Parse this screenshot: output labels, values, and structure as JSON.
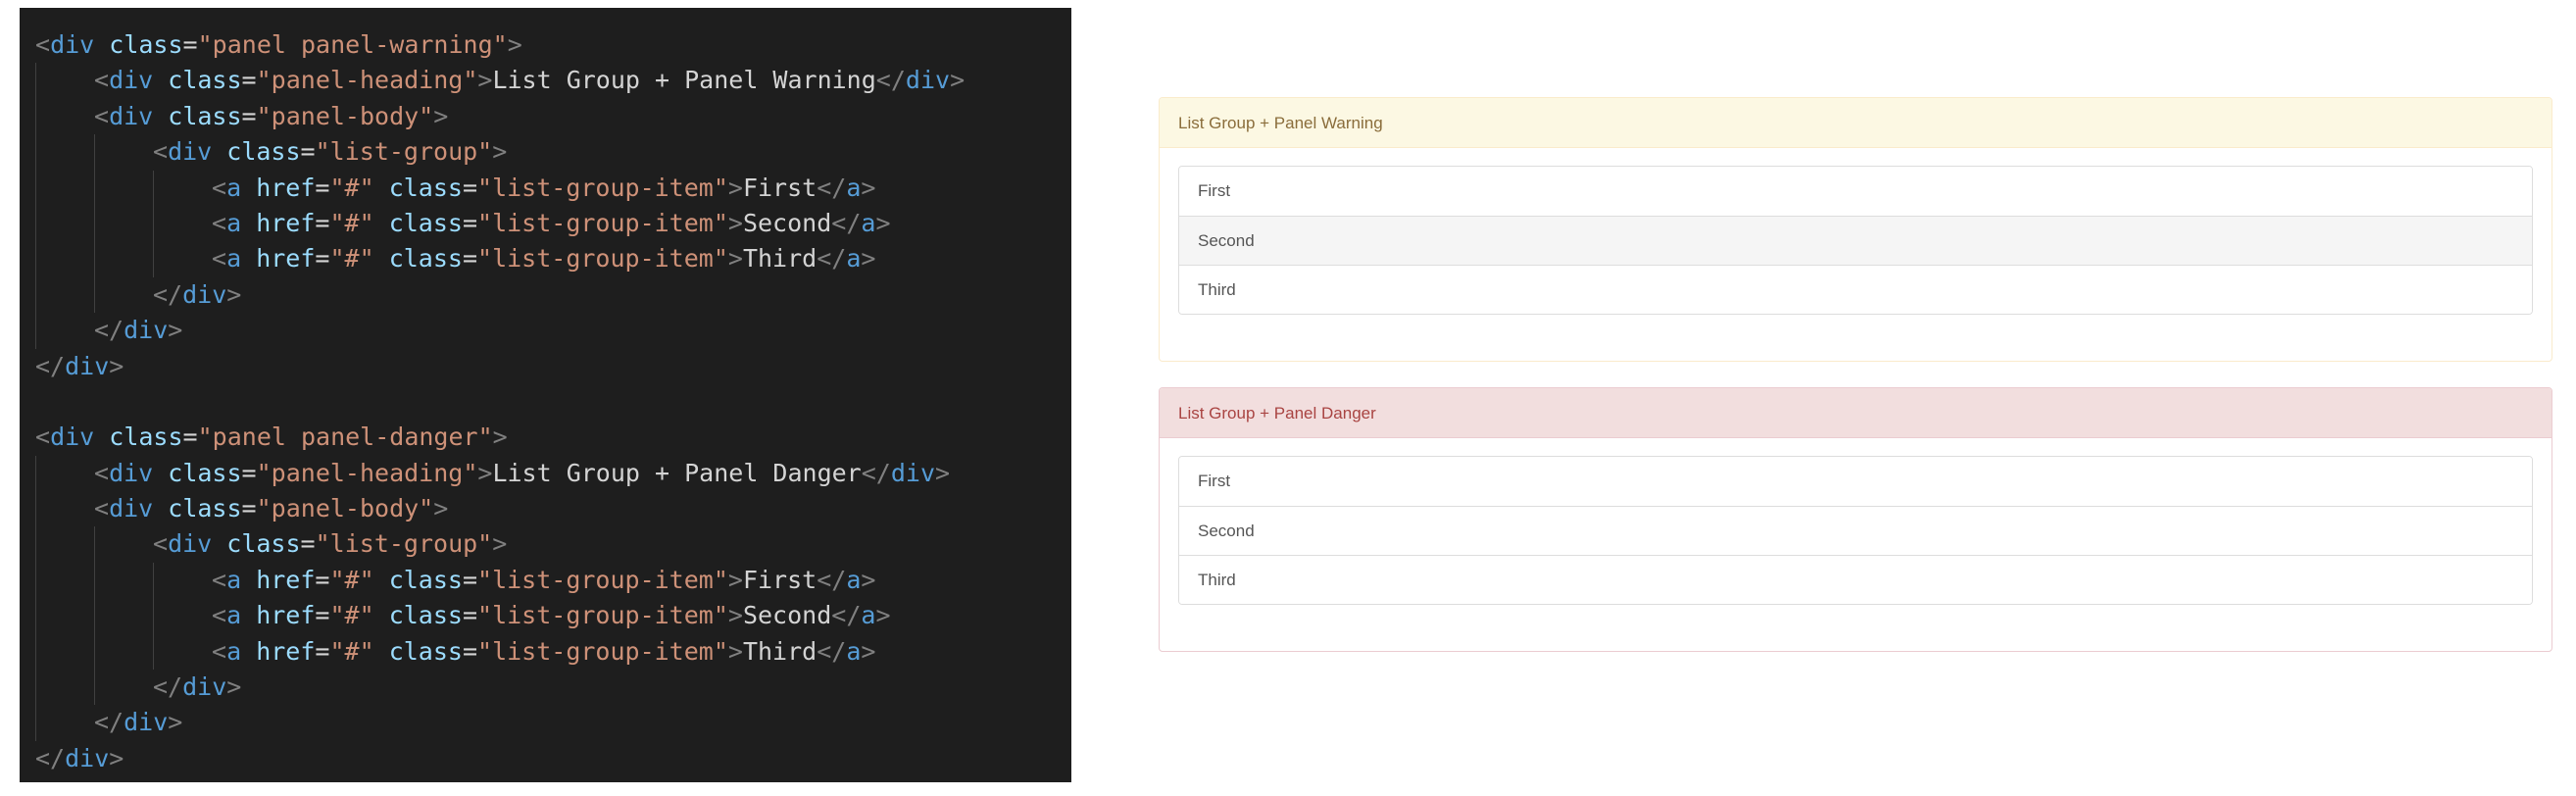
{
  "editor": {
    "lines": [
      {
        "indent": 0,
        "tokens": [
          [
            "bracket",
            "<"
          ],
          [
            "tag",
            "div"
          ],
          [
            "text",
            " "
          ],
          [
            "attr",
            "class"
          ],
          [
            "eq",
            "="
          ],
          [
            "str",
            "\"panel panel-warning\""
          ],
          [
            "bracket",
            ">"
          ]
        ]
      },
      {
        "indent": 1,
        "tokens": [
          [
            "bracket",
            "<"
          ],
          [
            "tag",
            "div"
          ],
          [
            "text",
            " "
          ],
          [
            "attr",
            "class"
          ],
          [
            "eq",
            "="
          ],
          [
            "str",
            "\"panel-heading\""
          ],
          [
            "bracket",
            ">"
          ],
          [
            "text",
            "List Group + Panel Warning"
          ],
          [
            "bracket",
            "</"
          ],
          [
            "tag",
            "div"
          ],
          [
            "bracket",
            ">"
          ]
        ]
      },
      {
        "indent": 1,
        "tokens": [
          [
            "bracket",
            "<"
          ],
          [
            "tag",
            "div"
          ],
          [
            "text",
            " "
          ],
          [
            "attr",
            "class"
          ],
          [
            "eq",
            "="
          ],
          [
            "str",
            "\"panel-body\""
          ],
          [
            "bracket",
            ">"
          ]
        ]
      },
      {
        "indent": 2,
        "tokens": [
          [
            "bracket",
            "<"
          ],
          [
            "tag",
            "div"
          ],
          [
            "text",
            " "
          ],
          [
            "attr",
            "class"
          ],
          [
            "eq",
            "="
          ],
          [
            "str",
            "\"list-group\""
          ],
          [
            "bracket",
            ">"
          ]
        ]
      },
      {
        "indent": 3,
        "tokens": [
          [
            "bracket",
            "<"
          ],
          [
            "tag",
            "a"
          ],
          [
            "text",
            " "
          ],
          [
            "attr",
            "href"
          ],
          [
            "eq",
            "="
          ],
          [
            "str",
            "\"#\""
          ],
          [
            "text",
            " "
          ],
          [
            "attr",
            "class"
          ],
          [
            "eq",
            "="
          ],
          [
            "str",
            "\"list-group-item\""
          ],
          [
            "bracket",
            ">"
          ],
          [
            "text",
            "First"
          ],
          [
            "bracket",
            "</"
          ],
          [
            "tag",
            "a"
          ],
          [
            "bracket",
            ">"
          ]
        ]
      },
      {
        "indent": 3,
        "tokens": [
          [
            "bracket",
            "<"
          ],
          [
            "tag",
            "a"
          ],
          [
            "text",
            " "
          ],
          [
            "attr",
            "href"
          ],
          [
            "eq",
            "="
          ],
          [
            "str",
            "\"#\""
          ],
          [
            "text",
            " "
          ],
          [
            "attr",
            "class"
          ],
          [
            "eq",
            "="
          ],
          [
            "str",
            "\"list-group-item\""
          ],
          [
            "bracket",
            ">"
          ],
          [
            "text",
            "Second"
          ],
          [
            "bracket",
            "</"
          ],
          [
            "tag",
            "a"
          ],
          [
            "bracket",
            ">"
          ]
        ]
      },
      {
        "indent": 3,
        "tokens": [
          [
            "bracket",
            "<"
          ],
          [
            "tag",
            "a"
          ],
          [
            "text",
            " "
          ],
          [
            "attr",
            "href"
          ],
          [
            "eq",
            "="
          ],
          [
            "str",
            "\"#\""
          ],
          [
            "text",
            " "
          ],
          [
            "attr",
            "class"
          ],
          [
            "eq",
            "="
          ],
          [
            "str",
            "\"list-group-item\""
          ],
          [
            "bracket",
            ">"
          ],
          [
            "text",
            "Third"
          ],
          [
            "bracket",
            "</"
          ],
          [
            "tag",
            "a"
          ],
          [
            "bracket",
            ">"
          ]
        ]
      },
      {
        "indent": 2,
        "tokens": [
          [
            "bracket",
            "</"
          ],
          [
            "tag",
            "div"
          ],
          [
            "bracket",
            ">"
          ]
        ]
      },
      {
        "indent": 1,
        "tokens": [
          [
            "bracket",
            "</"
          ],
          [
            "tag",
            "div"
          ],
          [
            "bracket",
            ">"
          ]
        ]
      },
      {
        "indent": 0,
        "tokens": [
          [
            "bracket",
            "</"
          ],
          [
            "tag",
            "div"
          ],
          [
            "bracket",
            ">"
          ]
        ]
      },
      {
        "indent": 0,
        "tokens": []
      },
      {
        "indent": 0,
        "tokens": [
          [
            "bracket",
            "<"
          ],
          [
            "tag",
            "div"
          ],
          [
            "text",
            " "
          ],
          [
            "attr",
            "class"
          ],
          [
            "eq",
            "="
          ],
          [
            "str",
            "\"panel panel-danger\""
          ],
          [
            "bracket",
            ">"
          ]
        ]
      },
      {
        "indent": 1,
        "tokens": [
          [
            "bracket",
            "<"
          ],
          [
            "tag",
            "div"
          ],
          [
            "text",
            " "
          ],
          [
            "attr",
            "class"
          ],
          [
            "eq",
            "="
          ],
          [
            "str",
            "\"panel-heading\""
          ],
          [
            "bracket",
            ">"
          ],
          [
            "text",
            "List Group + Panel Danger"
          ],
          [
            "bracket",
            "</"
          ],
          [
            "tag",
            "div"
          ],
          [
            "bracket",
            ">"
          ]
        ]
      },
      {
        "indent": 1,
        "tokens": [
          [
            "bracket",
            "<"
          ],
          [
            "tag",
            "div"
          ],
          [
            "text",
            " "
          ],
          [
            "attr",
            "class"
          ],
          [
            "eq",
            "="
          ],
          [
            "str",
            "\"panel-body\""
          ],
          [
            "bracket",
            ">"
          ]
        ]
      },
      {
        "indent": 2,
        "tokens": [
          [
            "bracket",
            "<"
          ],
          [
            "tag",
            "div"
          ],
          [
            "text",
            " "
          ],
          [
            "attr",
            "class"
          ],
          [
            "eq",
            "="
          ],
          [
            "str",
            "\"list-group\""
          ],
          [
            "bracket",
            ">"
          ]
        ]
      },
      {
        "indent": 3,
        "tokens": [
          [
            "bracket",
            "<"
          ],
          [
            "tag",
            "a"
          ],
          [
            "text",
            " "
          ],
          [
            "attr",
            "href"
          ],
          [
            "eq",
            "="
          ],
          [
            "str",
            "\"#\""
          ],
          [
            "text",
            " "
          ],
          [
            "attr",
            "class"
          ],
          [
            "eq",
            "="
          ],
          [
            "str",
            "\"list-group-item\""
          ],
          [
            "bracket",
            ">"
          ],
          [
            "text",
            "First"
          ],
          [
            "bracket",
            "</"
          ],
          [
            "tag",
            "a"
          ],
          [
            "bracket",
            ">"
          ]
        ]
      },
      {
        "indent": 3,
        "tokens": [
          [
            "bracket",
            "<"
          ],
          [
            "tag",
            "a"
          ],
          [
            "text",
            " "
          ],
          [
            "attr",
            "href"
          ],
          [
            "eq",
            "="
          ],
          [
            "str",
            "\"#\""
          ],
          [
            "text",
            " "
          ],
          [
            "attr",
            "class"
          ],
          [
            "eq",
            "="
          ],
          [
            "str",
            "\"list-group-item\""
          ],
          [
            "bracket",
            ">"
          ],
          [
            "text",
            "Second"
          ],
          [
            "bracket",
            "</"
          ],
          [
            "tag",
            "a"
          ],
          [
            "bracket",
            ">"
          ]
        ]
      },
      {
        "indent": 3,
        "tokens": [
          [
            "bracket",
            "<"
          ],
          [
            "tag",
            "a"
          ],
          [
            "text",
            " "
          ],
          [
            "attr",
            "href"
          ],
          [
            "eq",
            "="
          ],
          [
            "str",
            "\"#\""
          ],
          [
            "text",
            " "
          ],
          [
            "attr",
            "class"
          ],
          [
            "eq",
            "="
          ],
          [
            "str",
            "\"list-group-item\""
          ],
          [
            "bracket",
            ">"
          ],
          [
            "text",
            "Third"
          ],
          [
            "bracket",
            "</"
          ],
          [
            "tag",
            "a"
          ],
          [
            "bracket",
            ">"
          ]
        ]
      },
      {
        "indent": 2,
        "tokens": [
          [
            "bracket",
            "</"
          ],
          [
            "tag",
            "div"
          ],
          [
            "bracket",
            ">"
          ]
        ]
      },
      {
        "indent": 1,
        "tokens": [
          [
            "bracket",
            "</"
          ],
          [
            "tag",
            "div"
          ],
          [
            "bracket",
            ">"
          ]
        ]
      },
      {
        "indent": 0,
        "tokens": [
          [
            "bracket",
            "</"
          ],
          [
            "tag",
            "div"
          ],
          [
            "bracket",
            ">"
          ]
        ]
      }
    ]
  },
  "preview": {
    "warning": {
      "heading": "List Group + Panel Warning",
      "items": [
        "First",
        "Second",
        "Third"
      ]
    },
    "danger": {
      "heading": "List Group + Panel Danger",
      "items": [
        "First",
        "Second",
        "Third"
      ]
    }
  },
  "colors": {
    "editor_bg": "#1e1e1e",
    "tag": "#569cd6",
    "attr": "#9cdcfe",
    "string": "#ce9178",
    "warning_heading_bg": "#fcf8e3",
    "warning_heading_text": "#8a6d3b",
    "danger_heading_bg": "#f2dede",
    "danger_heading_text": "#a94442"
  }
}
